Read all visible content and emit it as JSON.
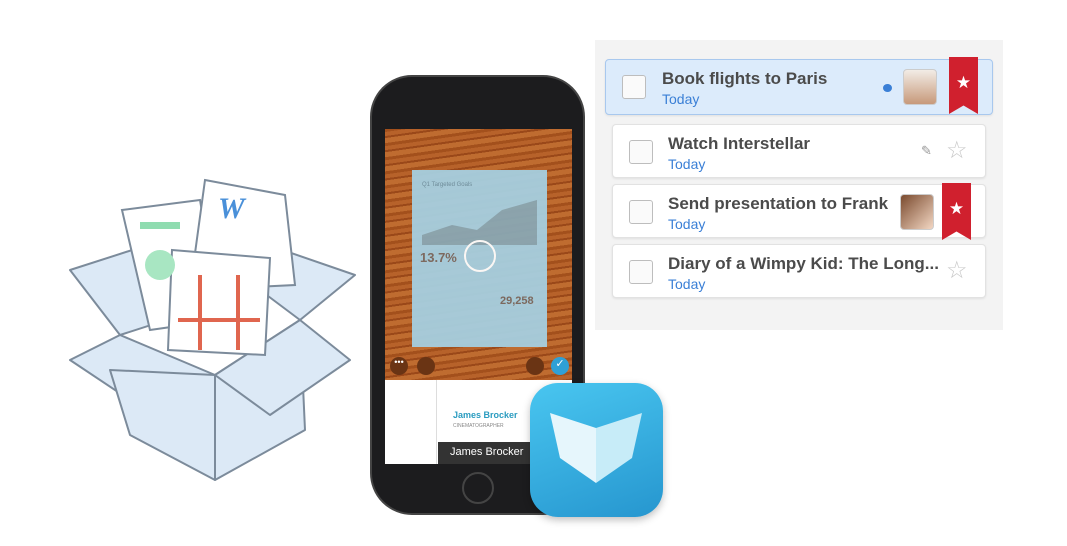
{
  "tasks": [
    {
      "title": "Book flights to Paris",
      "due": "Today",
      "selected": true,
      "starred": true,
      "has_comment": true,
      "assignee": "avatar-man"
    },
    {
      "title": "Watch Interstellar",
      "due": "Today",
      "selected": false,
      "starred": false,
      "pinned": true
    },
    {
      "title": "Send presentation to Frank",
      "due": "Today",
      "selected": false,
      "starred": true,
      "assignee": "avatar-woman"
    },
    {
      "title": "Diary of a Wimpy Kid: The Long...",
      "due": "Today",
      "selected": false,
      "starred": false
    }
  ],
  "scan": {
    "doc_title": "Q1 Targeted Goals",
    "stat1": "13.7%",
    "stat2": "29,258",
    "card_name": "James Brocker",
    "card_role": "CINEMATOGRAPHER",
    "caption": "James Brocker"
  },
  "illustration": {
    "word_letter": "W"
  },
  "colors": {
    "accent_blue": "#3a7fd6",
    "star_red": "#d0202e",
    "app_icon": "#3bb7e8"
  }
}
